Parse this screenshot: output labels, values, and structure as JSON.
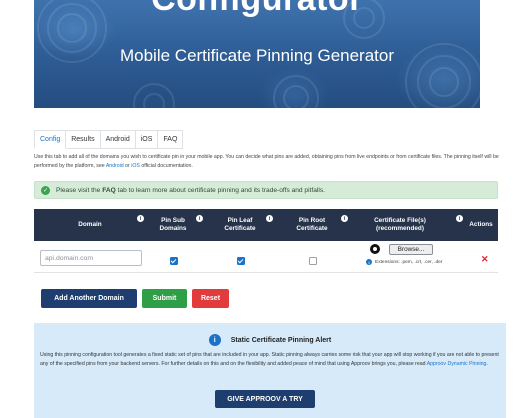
{
  "hero": {
    "top_text": "Configurator",
    "title": "Mobile Certificate Pinning Generator"
  },
  "tabs": [
    {
      "label": "Config",
      "active": true
    },
    {
      "label": "Results",
      "active": false
    },
    {
      "label": "Android",
      "active": false
    },
    {
      "label": "iOS",
      "active": false
    },
    {
      "label": "FAQ",
      "active": false
    }
  ],
  "intro": {
    "text": "Use this tab to add all of the domains you wish to certificate pin in your mobile app. You can decide what pins are added, obtaining pins from live endpoints or from certificate files. The pinning itself will be performed by the platform, see",
    "android_link": "Android",
    "or": "or",
    "ios_link": "iOS",
    "suffix": "official documentation."
  },
  "notice": {
    "prefix": "Please visit the",
    "faq": "FAQ",
    "suffix": "tab to learn more about certificate pinning and its trade-offs and pitfalls."
  },
  "table": {
    "headers": {
      "domain": "Domain",
      "pin_sub": "Pin Sub Domains",
      "pin_leaf": "Pin Leaf Certificate",
      "pin_root": "Pin Root Certificate",
      "cert_files": "Certificate File(s) (recommended)",
      "actions": "Actions"
    },
    "row": {
      "domain_placeholder": "api.domain.com",
      "domain_value": "",
      "pin_sub_domains": true,
      "pin_leaf_certificate": true,
      "pin_root_certificate": false,
      "browse_label": "Browse...",
      "extensions": "Extensions: .pem, .crt, .cer, .der",
      "delete_glyph": "✕"
    }
  },
  "buttons": {
    "add_domain": "Add Another Domain",
    "submit": "Submit",
    "reset": "Reset"
  },
  "alert": {
    "title": "Static Certificate Pinning Alert",
    "body": "Using this pinning configuration tool generates a fixed static set of pins that are included in your app. Static pinning always carries some risk that your app will stop working if you are not able to present any of the specified pins from your backend servers. For further details on this and on the flexibility and added peace of mind that using Approov brings you, please read",
    "link": "Approov Dynamic Pinning",
    "cta": "GIVE APPROOV A TRY"
  },
  "colors": {
    "header_bg": "#26334a",
    "primary_blue": "#1d3e6f",
    "submit_green": "#2e9f46",
    "reset_red": "#e13b3b",
    "link_blue": "#1a73c8",
    "success_bg": "#d6ecd9",
    "alert_bg": "#d7eaf9"
  },
  "icons": {
    "info": "info-icon",
    "check": "check-circle-icon",
    "file": "github-file-icon",
    "delete": "close-icon"
  }
}
